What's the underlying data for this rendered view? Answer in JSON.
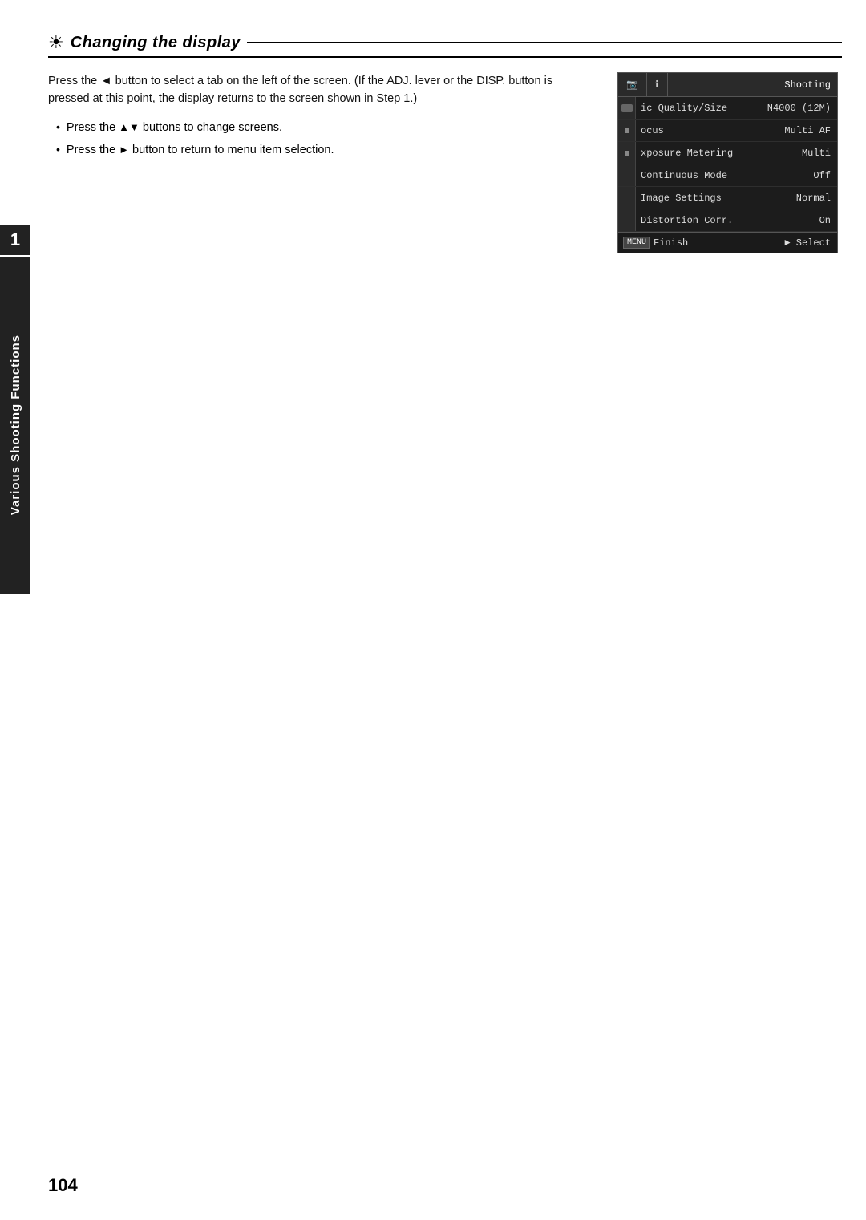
{
  "page": {
    "number": "104",
    "side_tab_number": "1",
    "side_tab_label": "Various Shooting Functions"
  },
  "title": {
    "icon": "☀",
    "text": "Changing the display"
  },
  "body": {
    "paragraph": "Press the ◄ button to select a tab on the left of the screen. (If the ADJ. lever or the DISP. button is pressed at this point, the display returns to the screen shown in Step 1.)",
    "bullet1_prefix": "Press the ",
    "bullet1_arrows": "▲▼",
    "bullet1_suffix": " buttons to change screens.",
    "bullet2_prefix": "Press the ",
    "bullet2_arrow": "►",
    "bullet2_suffix": " button to return to menu item selection."
  },
  "camera_menu": {
    "tabs": [
      {
        "icon": "📷",
        "label": ""
      },
      {
        "icon": "ℹ",
        "label": ""
      }
    ],
    "shooting_label": "Shooting",
    "rows": [
      {
        "indicator": "icon",
        "label": "ic Quality/Size",
        "value": "N4000 (12M)"
      },
      {
        "indicator": "dot",
        "label": "ocus",
        "value": "Multi AF"
      },
      {
        "indicator": "dot",
        "label": "xposure Metering",
        "value": "Multi"
      },
      {
        "indicator": "none",
        "label": "Continuous Mode",
        "value": "Off"
      },
      {
        "indicator": "none",
        "label": "Image Settings",
        "value": "Normal"
      },
      {
        "indicator": "none",
        "label": "Distortion Corr.",
        "value": "On"
      }
    ],
    "footer": {
      "menu_btn": "MENU",
      "finish": "Finish",
      "select": "► Select"
    }
  }
}
